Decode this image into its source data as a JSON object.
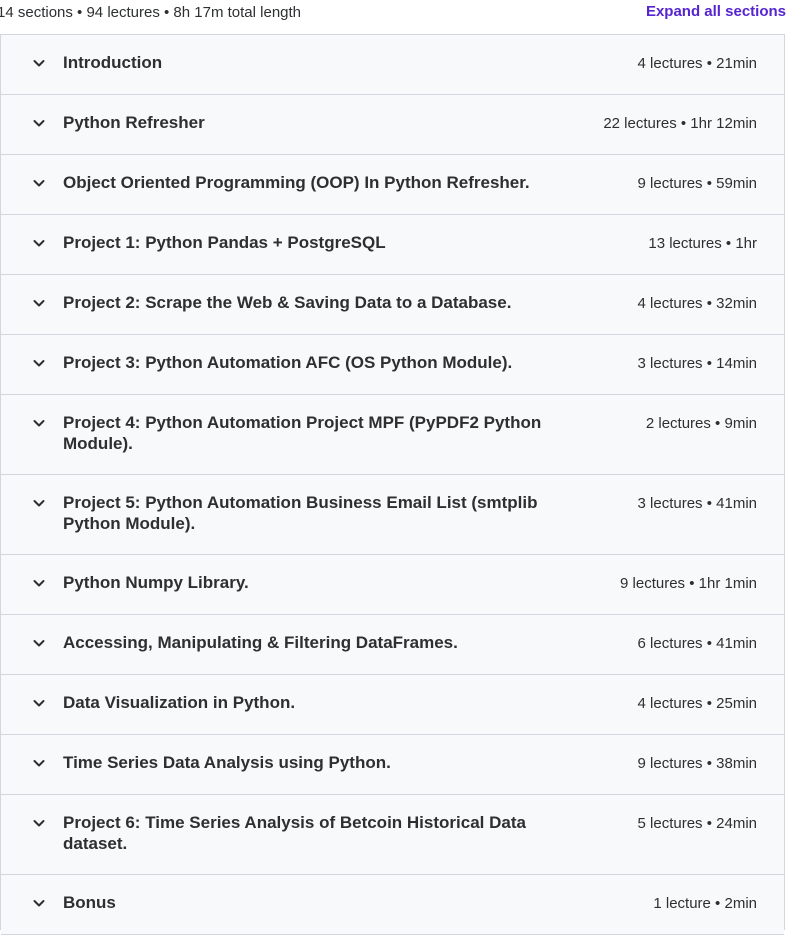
{
  "summary": {
    "text": "14 sections • 94 lectures • 8h 17m total length",
    "expand_label": "Expand all sections"
  },
  "colors": {
    "accent": "#5624d0",
    "text": "#2d2f31",
    "section_bg": "#f7f9fa",
    "border": "#d1d7dc"
  },
  "sections": [
    {
      "title": "Introduction",
      "meta": "4 lectures • 21min",
      "icon": "chevron-down-icon"
    },
    {
      "title": "Python Refresher",
      "meta": "22 lectures • 1hr 12min",
      "icon": "chevron-down-icon"
    },
    {
      "title": "Object Oriented Programming (OOP) In Python Refresher.",
      "meta": "9 lectures • 59min",
      "icon": "chevron-down-icon"
    },
    {
      "title": "Project 1: Python Pandas + PostgreSQL",
      "meta": "13 lectures • 1hr",
      "icon": "chevron-down-icon"
    },
    {
      "title": "Project 2: Scrape the Web & Saving Data to a Database.",
      "meta": "4 lectures • 32min",
      "icon": "chevron-down-icon"
    },
    {
      "title": "Project 3: Python Automation AFC (OS Python Module).",
      "meta": "3 lectures • 14min",
      "icon": "chevron-down-icon"
    },
    {
      "title": "Project 4: Python Automation Project MPF (PyPDF2 Python Module).",
      "meta": "2 lectures • 9min",
      "icon": "chevron-down-icon"
    },
    {
      "title": "Project 5: Python Automation Business Email List (smtplib Python Module).",
      "meta": "3 lectures • 41min",
      "icon": "chevron-down-icon"
    },
    {
      "title": "Python Numpy Library.",
      "meta": "9 lectures • 1hr 1min",
      "icon": "chevron-down-icon"
    },
    {
      "title": "Accessing, Manipulating & Filtering DataFrames.",
      "meta": "6 lectures • 41min",
      "icon": "chevron-down-icon"
    },
    {
      "title": "Data Visualization in Python.",
      "meta": "4 lectures • 25min",
      "icon": "chevron-down-icon"
    },
    {
      "title": "Time Series Data Analysis using Python.",
      "meta": "9 lectures • 38min",
      "icon": "chevron-down-icon"
    },
    {
      "title": "Project 6: Time Series Analysis of Betcoin Historical Data dataset.",
      "meta": "5 lectures • 24min",
      "icon": "chevron-down-icon"
    },
    {
      "title": "Bonus",
      "meta": "1 lecture • 2min",
      "icon": "chevron-down-icon"
    }
  ]
}
